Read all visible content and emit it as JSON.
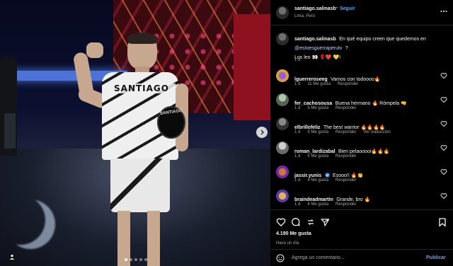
{
  "post": {
    "username": "santiago.salinasb",
    "follow_label": "Seguir",
    "location": "Lima, Perú",
    "caption": {
      "username": "santiago.salinasb",
      "text_before_mention": "En qué equipo creen que quedemos en",
      "mention": "@estoesguerraperutv",
      "text_after_mention": "?",
      "second_line": "Los leo 👀 🌹❤️ 💛!",
      "age": "1 d"
    },
    "photo": {
      "shirt_text": "SANTIAGO",
      "helmet_text": "SANTIAGO",
      "carousel_dots": 5,
      "active_dot": 0
    },
    "comments": [
      {
        "username": "lguerreroseeg",
        "text": "Vamos con todoooo🔥",
        "age": "1 d",
        "likes": "11 Me gusta",
        "reply": "Responder",
        "extra": ""
      },
      {
        "username": "fer_cachosousa",
        "text": "Buena hermano 🔥 Rómpela 🤜",
        "age": "1 d",
        "likes": "5 Me gusta",
        "reply": "Responder",
        "extra": ""
      },
      {
        "username": "elbrillofeliz",
        "text": "The best warrior 🔥🔥🔥🔥",
        "age": "1 d",
        "likes": "5 Me gusta",
        "reply": "Responder",
        "extra": "Ver traducción"
      },
      {
        "username": "roman_lardizabal",
        "text": "Bien pelaooooi🔥🔥🔥",
        "age": "1 d",
        "likes": "5 Me gusta",
        "reply": "Responder",
        "extra": ""
      },
      {
        "username": "jassir.yunis",
        "text": "Esooo!! 🔥👏",
        "age": "1 d",
        "likes": "4 Me gusta",
        "reply": "Responder",
        "extra": ""
      },
      {
        "username": "braindeadmartin",
        "text": "Grande, bro 🔥",
        "age": "1 d",
        "likes": "4 Me gusta",
        "reply": "Responder",
        "extra": ""
      }
    ],
    "like_count": "4.190 Me gusta",
    "posted_ago": "Hace un día",
    "comment_placeholder": "Agrega un comentario...",
    "publish_label": "Publicar"
  },
  "colors": {
    "background": "#000000",
    "link": "#4ea3ff",
    "muted": "#a8a8a8",
    "verified": "#3897f0"
  },
  "icons": [
    "heart-icon",
    "comment-icon",
    "share-icon",
    "save-icon",
    "emoji-icon",
    "next-arrow-icon",
    "tag-icon",
    "more-icon"
  ]
}
